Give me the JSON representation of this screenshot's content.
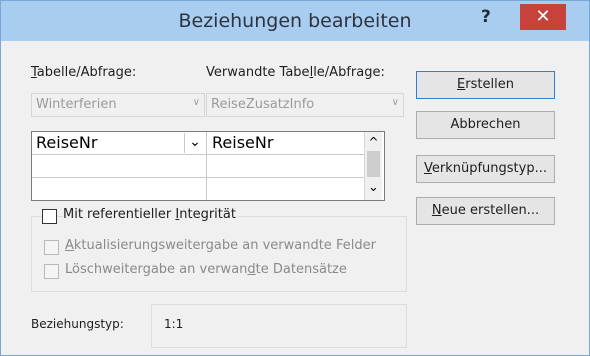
{
  "titlebar": {
    "title": "Beziehungen bearbeiten",
    "help_label": "?",
    "close_label": "✕"
  },
  "left": {
    "label_prefix": "T",
    "label_rest": "abelle/Abfrage:",
    "combo_value": "Winterferien",
    "rows": [
      "ReiseNr",
      "",
      ""
    ]
  },
  "right": {
    "label_pre": "Verwandte Tabe",
    "label_ul": "l",
    "label_post": "le/Abfrage:",
    "combo_value": "ReiseZusatzInfo",
    "rows": [
      "ReiseNr",
      "",
      ""
    ]
  },
  "buttons": {
    "create_ul": "E",
    "create_rest": "rstellen",
    "cancel": "Abbrechen",
    "jointype_ul": "V",
    "jointype_rest": "erknüpfungstyp...",
    "new_ul": "N",
    "new_rest": "eue erstellen..."
  },
  "integrity": {
    "main_pre": "Mit referentieller ",
    "main_ul": "I",
    "main_post": "ntegrität",
    "cascade_update_ul": "A",
    "cascade_update_rest": "ktualisierungsweitergabe an verwandte Felder",
    "cascade_delete_pre": "Löschweitergabe an verwan",
    "cascade_delete_ul": "d",
    "cascade_delete_post": "te Datensätze"
  },
  "relationship": {
    "label": "Beziehungstyp:",
    "value": "1:1"
  },
  "arrow_glyphs": {
    "dropdown": "∨",
    "cell_dropdown": "⌄",
    "scroll_up": "^",
    "scroll_down": "⌄"
  },
  "colors": {
    "titlebar": "#a9cdf1",
    "close": "#c7423b",
    "dialog_bg": "#f0f0f0",
    "primary_border": "#2f7fd4"
  }
}
